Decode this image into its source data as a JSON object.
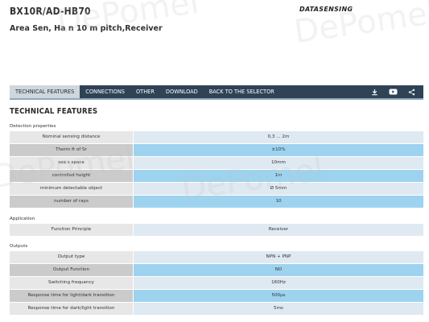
{
  "header": {
    "product_code": "BX10R/AD-HB70",
    "product_desc": "Area Sen, Ha     n 10 m  pitch,Receiver",
    "brand": "DATASENSING"
  },
  "tabs": [
    {
      "label": "TECHNICAL FEATURES",
      "active": true
    },
    {
      "label": "CONNECTIONS",
      "active": false
    },
    {
      "label": "OTHER",
      "active": false
    },
    {
      "label": "DOWNLOAD",
      "active": false
    },
    {
      "label": "BACK TO THE SELECTOR",
      "active": false
    }
  ],
  "toolbar_icons": [
    "download-icon",
    "youtube-icon",
    "share-icon"
  ],
  "section_title": "TECHNICAL FEATURES",
  "groups": [
    {
      "label": "Detection properties",
      "rows": [
        {
          "k": "Nominal sensing distance",
          "v": "0,3 ... 2m"
        },
        {
          "k": "Therm   ft of Sr",
          "v": "±10%"
        },
        {
          "k": "  sea   s space",
          "v": "10mm"
        },
        {
          "k": "controlled height",
          "v": "1m"
        },
        {
          "k": "minimum detectable object",
          "v": "Ø 5mm"
        },
        {
          "k": "number of rays",
          "v": "10"
        }
      ]
    },
    {
      "label": "Application",
      "rows": [
        {
          "k": "Function Principle",
          "v": "Receiver"
        }
      ]
    },
    {
      "label": "Outputs",
      "rows": [
        {
          "k": "Output type",
          "v": "NPN + PNP"
        },
        {
          "k": "Output Function",
          "v": "NO"
        },
        {
          "k": "Switching frequency",
          "v": "160Hz"
        },
        {
          "k": "Response time for light/dark transition",
          "v": "500μs"
        },
        {
          "k": "Response time for dark/light transition",
          "v": "5ms"
        }
      ]
    }
  ],
  "watermark_text": "DePomel",
  "colors": {
    "tabbar": "#2f4256",
    "row_highlight": "#9dd3ef",
    "row_light": "#dfe9f2"
  }
}
